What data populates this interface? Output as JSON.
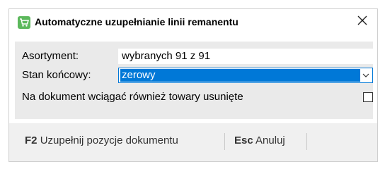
{
  "window": {
    "title": "Automatyczne uzupełnianie linii remanentu",
    "icon": "cart-icon",
    "accent_color": "#4caf50"
  },
  "form": {
    "assortment_label": "Asortyment:",
    "assortment_value": "wybranych 91 z 91",
    "end_state_label": "Stan końcowy:",
    "end_state_value": "zerowy",
    "include_deleted_label": "Na dokument wciągać również towary usunięte",
    "include_deleted_checked": false
  },
  "footer": {
    "fill_key": "F2",
    "fill_label": "Uzupełnij pozycje dokumentu",
    "cancel_key": "Esc",
    "cancel_label": "Anuluj"
  },
  "colors": {
    "selection": "#0078d7",
    "panel": "#eaeaea",
    "footer": "#f0f0f0"
  }
}
